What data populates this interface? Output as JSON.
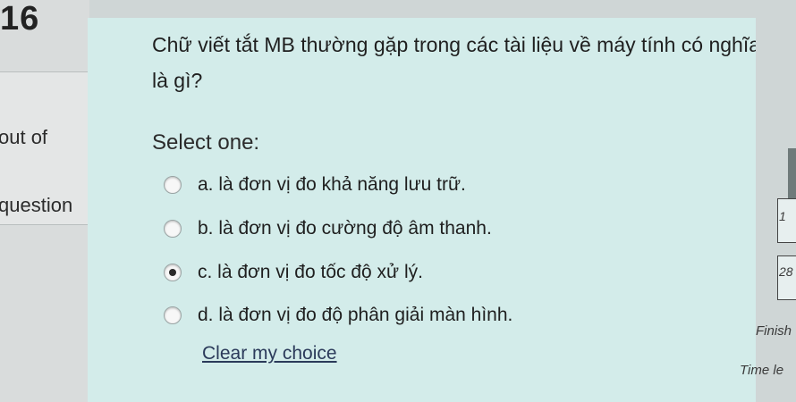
{
  "question": {
    "number": "16",
    "out_of_label": "out of",
    "question_label": "question",
    "text": "Chữ viết tắt MB thường gặp trong các tài liệu về máy tính có nghĩa là gì?",
    "select_label": "Select one:",
    "options": [
      {
        "label": "a. là đơn vị đo khả năng lưu trữ.",
        "selected": false
      },
      {
        "label": "b. là đơn vị đo cường độ âm thanh.",
        "selected": false
      },
      {
        "label": "c. là đơn vị đo tốc độ xử lý.",
        "selected": true
      },
      {
        "label": "d. là đơn vị đo độ phân giải màn hình.",
        "selected": false
      }
    ],
    "clear_label": "Clear my choice"
  },
  "quiz_nav": {
    "box_1_text": "1",
    "box_2_text": "28",
    "finish_label": "Finish",
    "time_left_label": "Time le"
  }
}
